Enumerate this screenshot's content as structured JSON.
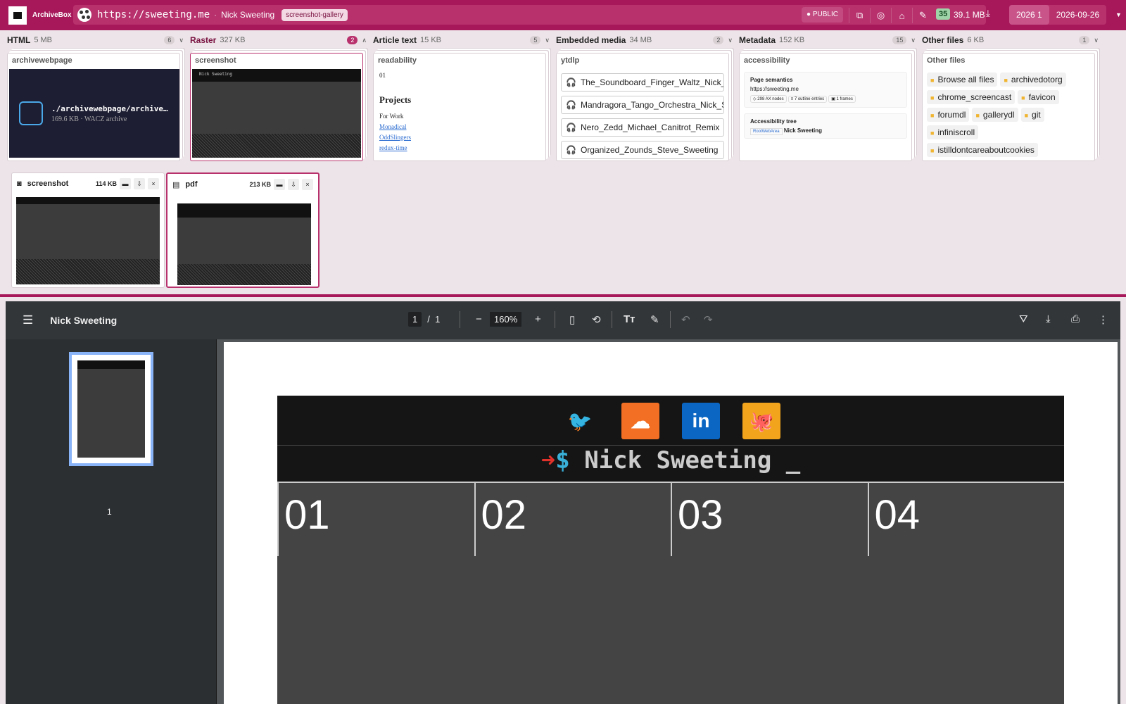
{
  "topbar": {
    "brand": "ArchiveBox",
    "url": "https://sweeting.me",
    "separator": "·",
    "page_title": "Nick Sweeting",
    "tag": "screenshot-gallery",
    "public_label": "PUBLIC",
    "count": "35",
    "size": "39.1 MB",
    "year_label": "2026",
    "year_count": "1",
    "date": "2026-09-26"
  },
  "columns": [
    {
      "title": "HTML",
      "size": "5 MB",
      "count": "6",
      "chevron": "∨"
    },
    {
      "title": "Raster",
      "size": "327 KB",
      "count": "2",
      "chevron": "∧"
    },
    {
      "title": "Article text",
      "size": "15 KB",
      "count": "5",
      "chevron": "∨"
    },
    {
      "title": "Embedded media",
      "size": "34 MB",
      "count": "2",
      "chevron": "∨"
    },
    {
      "title": "Metadata",
      "size": "152 KB",
      "count": "15",
      "chevron": "∨"
    },
    {
      "title": "Other files",
      "size": "6 KB",
      "count": "1",
      "chevron": "∨"
    }
  ],
  "html_card": {
    "title": "archivewebpage",
    "filename": "./archivewebpage/archivewebpage.wacz",
    "meta": "169.6 KB · WACZ archive"
  },
  "raster_card": {
    "title": "screenshot",
    "site_name": "Nick Sweeting"
  },
  "article_card": {
    "title": "readability",
    "num": "01",
    "heading": "Projects",
    "sub": "For Work",
    "links": [
      "Monadical",
      "OddSlingers",
      "redux-time"
    ]
  },
  "media_card": {
    "title": "ytdlp",
    "items": [
      "The_Soundboard_Finger_Waltz_Nick_Sweeting",
      "Mandragora_Tango_Orchestra_Nick_Sweeting",
      "Nero_Zedd_Michael_Canitrot_Remix",
      "Organized_Zounds_Steve_Sweeting"
    ]
  },
  "meta_card": {
    "title": "accessibility",
    "sem_title": "Page semantics",
    "sem_url": "https://sweeting.me",
    "chips": [
      "◇ 298 AX nodes",
      "≡ 7 outline entries",
      "▣ 1 frames"
    ],
    "tree_title": "Accessibility tree",
    "tree_root": "RootWebArea",
    "tree_name": "Nick Sweeting"
  },
  "files_card": {
    "title": "Other files",
    "items": [
      "Browse all files",
      "archivedotorg",
      "chrome_screencast",
      "favicon",
      "forumdl",
      "gallerydl",
      "git",
      "infiniscroll",
      "istilldontcareaboutcookies"
    ]
  },
  "screenshot_card": {
    "name": "screenshot",
    "size": "114 KB"
  },
  "pdf_card": {
    "name": "pdf",
    "size": "213 KB"
  },
  "viewer": {
    "title": "Nick Sweeting",
    "page_current": "1",
    "page_sep": "/",
    "page_total": "1",
    "zoom": "160%",
    "thumb_label": "1",
    "doc_name": "Nick Sweeting _",
    "tiles": [
      "01",
      "02",
      "03",
      "04"
    ],
    "socials": [
      "twitter-icon",
      "soundcloud-icon",
      "linkedin-icon",
      "github-icon"
    ],
    "linkedin_text": "in"
  },
  "colors": {
    "accent": "#a6185a",
    "twitter": "#1da1f2",
    "soundcloud": "#f26f23",
    "linkedin": "#0a66c2",
    "github": "#f2a41c"
  }
}
